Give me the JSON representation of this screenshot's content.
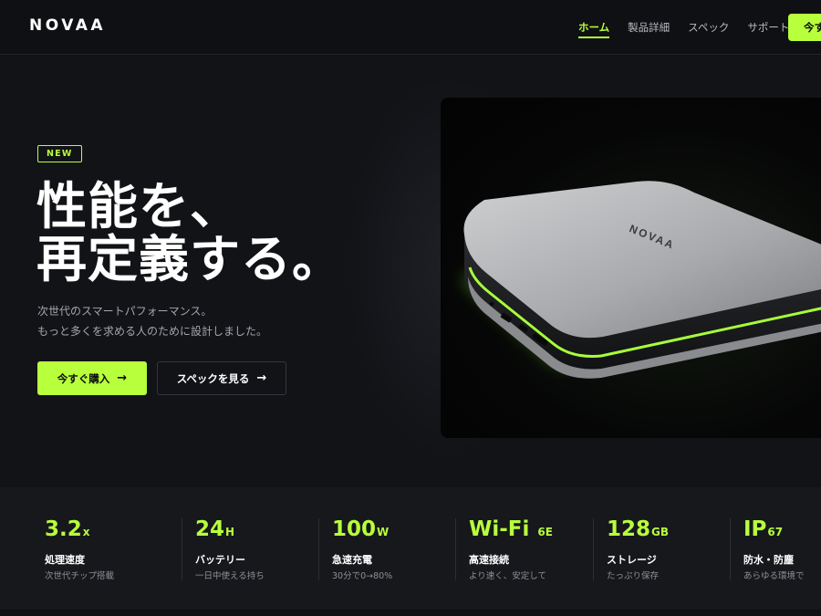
{
  "brand": {
    "logo": "NOVAA"
  },
  "nav": {
    "items": [
      {
        "label": "ホーム",
        "active": true
      },
      {
        "label": "製品詳細",
        "active": false
      },
      {
        "label": "スペック",
        "active": false
      },
      {
        "label": "サポート",
        "active": false
      }
    ],
    "cta_label": "今すぐ購入"
  },
  "hero": {
    "badge": "NEW",
    "headline_line1": "性能を、",
    "headline_line2": "再定義する。",
    "sub_line1": "次世代のスマートパフォーマンス。",
    "sub_line2": "もっと多くを求める人のために設計しました。",
    "primary_button": "今すぐ購入",
    "secondary_button": "スペックを見る",
    "arrow": "→",
    "product_logo": "NOVAA"
  },
  "stats": [
    {
      "value": "3.2",
      "unit": "x",
      "label": "処理速度",
      "sub": "次世代チップ搭載"
    },
    {
      "value": "24",
      "unit": "H",
      "label": "バッテリー",
      "sub": "一日中使える持ち"
    },
    {
      "value": "100",
      "unit": "W",
      "label": "急速充電",
      "sub": "30分で0→80%"
    },
    {
      "value": "Wi-Fi",
      "unit": "6E",
      "label": "高速接続",
      "sub": "より速く、安定して"
    },
    {
      "value": "128",
      "unit": "GB",
      "label": "ストレージ",
      "sub": "たっぷり保存"
    },
    {
      "value": "IP",
      "unit": "67",
      "label": "防水・防塵",
      "sub": "あらゆる環境で"
    }
  ],
  "colors": {
    "accent": "#b8ff3c",
    "background": "#0f1013",
    "panel": "#17181c"
  }
}
